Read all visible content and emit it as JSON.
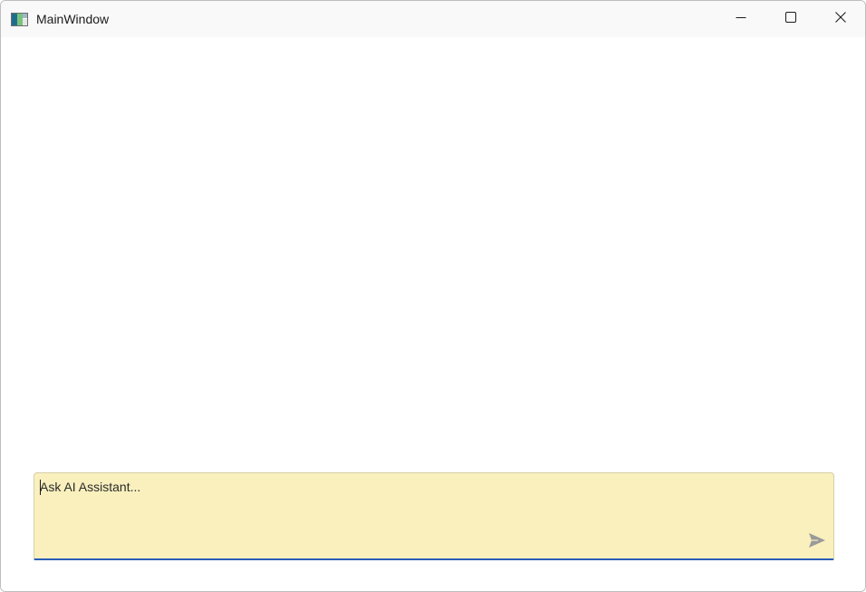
{
  "window": {
    "title": "MainWindow"
  },
  "titlebar_icons": {
    "app": "app-icon",
    "minimize": "minimize-icon",
    "maximize": "maximize-icon",
    "close": "close-icon"
  },
  "chat_input": {
    "placeholder": "Ask AI Assistant...",
    "value": "",
    "send_icon": "send-icon",
    "accent_color": "#2a5cb8",
    "background_color": "#f9f0bd"
  }
}
